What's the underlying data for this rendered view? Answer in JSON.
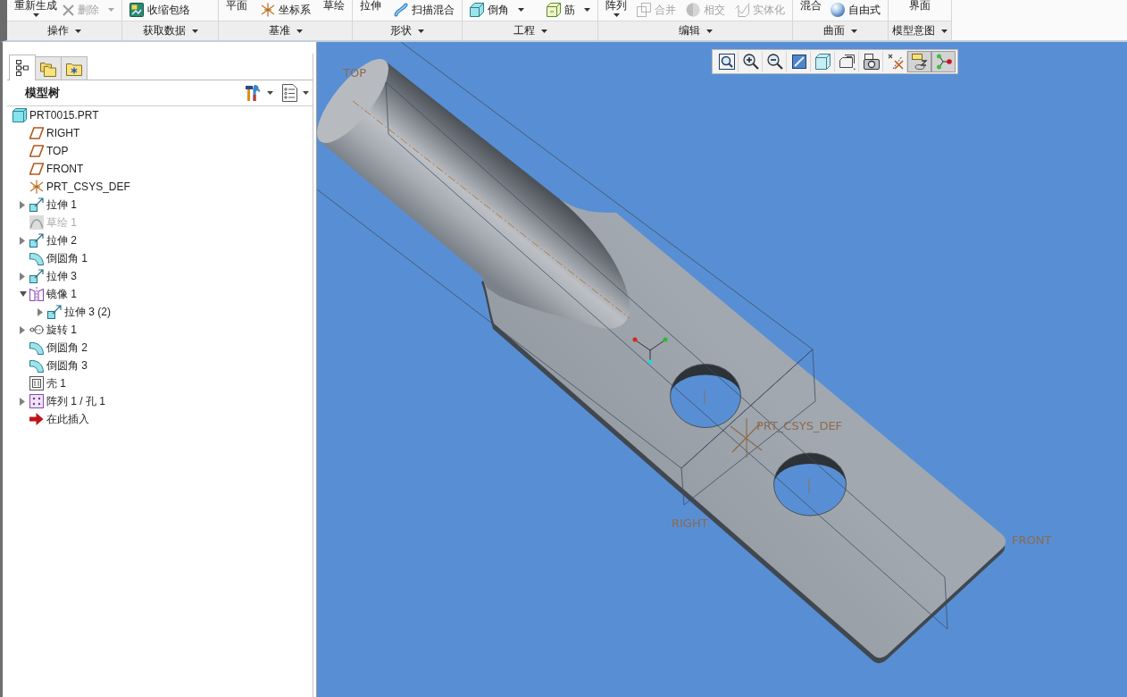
{
  "ribbon": {
    "groups": [
      {
        "label": "操作",
        "items": [
          {
            "label": "重新生成",
            "kind": "stacked",
            "dropdown": true,
            "disabled": false
          },
          {
            "label": "删除",
            "kind": "delete",
            "dropdown": true,
            "disabled": true
          }
        ]
      },
      {
        "label": "获取数据",
        "items": [
          {
            "label": "收缩包络",
            "kind": "shrinkwrap",
            "dropdown": false,
            "disabled": false
          }
        ]
      },
      {
        "label": "基准",
        "items": [
          {
            "label": "平面",
            "kind": "stacked",
            "dropdown": false,
            "disabled": false
          },
          {
            "label": "坐标系",
            "kind": "csys",
            "dropdown": false,
            "disabled": false
          },
          {
            "label": "草绘",
            "kind": "stacked",
            "dropdown": false,
            "disabled": false
          }
        ]
      },
      {
        "label": "形状",
        "items": [
          {
            "label": "拉伸",
            "kind": "stacked",
            "dropdown": false,
            "disabled": false
          },
          {
            "label": "扫描混合",
            "kind": "sweep",
            "dropdown": false,
            "disabled": false
          }
        ]
      },
      {
        "label": "工程",
        "items": [
          {
            "label": "倒角",
            "kind": "chamfer",
            "dropdown": true,
            "disabled": false
          },
          {
            "label": "筋",
            "kind": "rib",
            "dropdown": true,
            "disabled": false
          }
        ]
      },
      {
        "label": "编辑",
        "items": [
          {
            "label": "阵列",
            "kind": "stacked",
            "dropdown": true,
            "disabled": false
          },
          {
            "label": "合并",
            "kind": "merge",
            "dropdown": false,
            "disabled": true
          },
          {
            "label": "相交",
            "kind": "intersect",
            "dropdown": false,
            "disabled": true
          },
          {
            "label": "实体化",
            "kind": "solidify",
            "dropdown": false,
            "disabled": true
          }
        ]
      },
      {
        "label": "曲面",
        "items": [
          {
            "label": "混合",
            "kind": "stacked",
            "dropdown": false,
            "disabled": false
          },
          {
            "label": "自由式",
            "kind": "freestyle",
            "dropdown": false,
            "disabled": false
          }
        ]
      },
      {
        "label": "模型意图",
        "items": [
          {
            "label": "界面",
            "kind": "stacked",
            "dropdown": false,
            "disabled": false
          }
        ]
      }
    ]
  },
  "model_tree": {
    "tabs": [
      {
        "kind": "tree",
        "selected": true
      },
      {
        "kind": "folders",
        "selected": false
      },
      {
        "kind": "favorites",
        "selected": false
      }
    ],
    "title": "模型树",
    "items": [
      {
        "label": "PRT0015.PRT",
        "kind": "part",
        "disabled": false,
        "children": [
          {
            "label": "RIGHT",
            "kind": "plane",
            "disabled": false
          },
          {
            "label": "TOP",
            "kind": "plane",
            "disabled": false
          },
          {
            "label": "FRONT",
            "kind": "plane",
            "disabled": false
          },
          {
            "label": "PRT_CSYS_DEF",
            "kind": "csys",
            "disabled": false
          },
          {
            "label": "拉伸 1",
            "kind": "extrude",
            "disabled": false,
            "expanded": false
          },
          {
            "label": "草绘 1",
            "kind": "sketch",
            "disabled": true
          },
          {
            "label": "拉伸 2",
            "kind": "extrude",
            "disabled": false,
            "expanded": false
          },
          {
            "label": "倒圆角 1",
            "kind": "round",
            "disabled": false
          },
          {
            "label": "拉伸 3",
            "kind": "extrude",
            "disabled": false,
            "expanded": false
          },
          {
            "label": "镜像 1",
            "kind": "mirror",
            "disabled": false,
            "expanded": true,
            "children": [
              {
                "label": "拉伸 3 (2)",
                "kind": "extrude",
                "disabled": false,
                "expanded": false
              }
            ]
          },
          {
            "label": "旋转 1",
            "kind": "revolve",
            "disabled": false,
            "expanded": false
          },
          {
            "label": "倒圆角 2",
            "kind": "round",
            "disabled": false
          },
          {
            "label": "倒圆角 3",
            "kind": "round",
            "disabled": false
          },
          {
            "label": "壳 1",
            "kind": "shell",
            "disabled": false
          },
          {
            "label": "阵列 1 / 孔 1",
            "kind": "pattern",
            "disabled": false,
            "expanded": false
          },
          {
            "label": "在此插入",
            "kind": "insert",
            "disabled": false
          }
        ]
      }
    ]
  },
  "viewport": {
    "toolbar": [
      {
        "kind": "refit",
        "selected": false
      },
      {
        "kind": "zoom_in",
        "selected": false
      },
      {
        "kind": "zoom_out",
        "selected": false
      },
      {
        "kind": "repaint",
        "selected": false
      },
      {
        "kind": "display_style",
        "selected": false
      },
      {
        "kind": "saved_views",
        "selected": false
      },
      {
        "kind": "view_manager",
        "selected": false
      },
      {
        "kind": "datum_display",
        "selected": false
      },
      {
        "kind": "annotation_display",
        "selected": true
      },
      {
        "kind": "spin_center",
        "selected": true
      }
    ],
    "labels": [
      {
        "text": "TOP"
      },
      {
        "text": "PRT_CSYS_DEF"
      },
      {
        "text": "RIGHT"
      },
      {
        "text": "FRONT"
      }
    ]
  }
}
